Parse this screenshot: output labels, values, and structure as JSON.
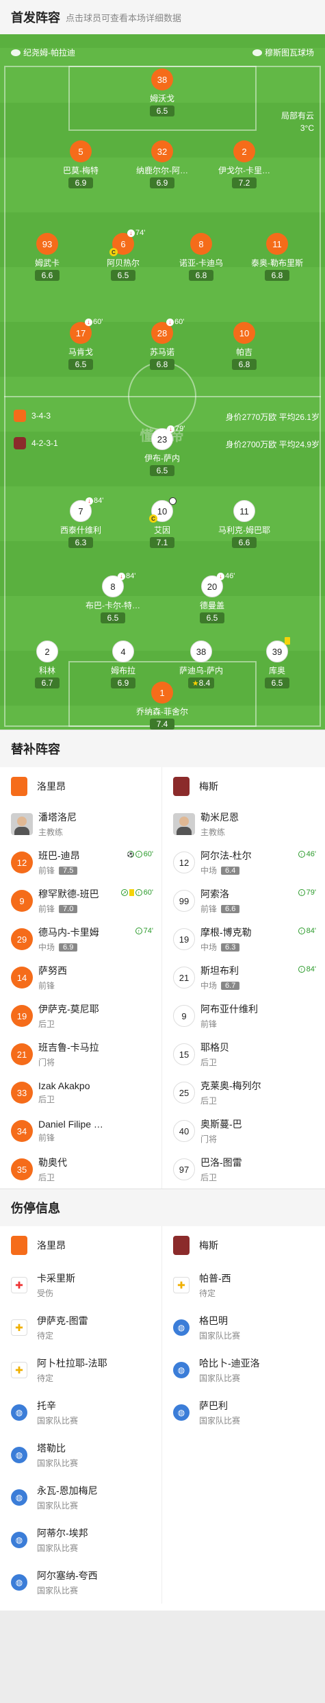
{
  "header": {
    "title": "首发阵容",
    "subtitle": "点击球员可查看本场详细数据"
  },
  "pitch": {
    "team_left": "纪尧姆-帕拉迪",
    "venue": "穆斯图瓦球场",
    "weather": "局部有云",
    "temperature": "3°C",
    "watermark": "懂球帝",
    "home_formation": "3-4-3",
    "home_value": "身价2770万欧 平均26.1岁",
    "away_formation": "4-2-3-1",
    "away_value": "身价2700万欧 平均24.9岁"
  },
  "home_players": [
    {
      "num": "38",
      "name": "姆沃戈",
      "rating": "6.5"
    },
    {
      "num": "5",
      "name": "巴莫-梅特",
      "rating": "6.9"
    },
    {
      "num": "32",
      "name": "纳鹿尔尔-阿…",
      "rating": "6.9"
    },
    {
      "num": "2",
      "name": "伊戈尔-卡里…",
      "rating": "7.2"
    },
    {
      "num": "93",
      "name": "姆武卡",
      "rating": "6.6"
    },
    {
      "num": "6",
      "name": "阿贝热尔",
      "rating": "6.5",
      "event": "74'"
    },
    {
      "num": "8",
      "name": "诺亚-卡迪乌",
      "rating": "6.8"
    },
    {
      "num": "11",
      "name": "泰奥-勒布里斯",
      "rating": "6.8"
    },
    {
      "num": "17",
      "name": "马肯戈",
      "rating": "6.5",
      "event": "60'"
    },
    {
      "num": "28",
      "name": "苏马诺",
      "rating": "6.8",
      "event": "60'"
    },
    {
      "num": "10",
      "name": "帕吉",
      "rating": "6.8"
    }
  ],
  "away_players": [
    {
      "num": "23",
      "name": "伊布-萨内",
      "rating": "6.5",
      "event": "79'"
    },
    {
      "num": "7",
      "name": "西泰什维利",
      "rating": "6.3",
      "event": "84'"
    },
    {
      "num": "10",
      "name": "艾因",
      "rating": "7.1"
    },
    {
      "num": "11",
      "name": "马利克-姆巴耶",
      "rating": "6.6"
    },
    {
      "num": "8",
      "name": "布巴-卡尔-特…",
      "rating": "6.5",
      "event": "84'"
    },
    {
      "num": "20",
      "name": "德曼盖",
      "rating": "6.5",
      "event": "46'"
    },
    {
      "num": "2",
      "name": "科林",
      "rating": "6.7"
    },
    {
      "num": "4",
      "name": "姆布拉",
      "rating": "6.9"
    },
    {
      "num": "38",
      "name": "萨迪乌-萨内",
      "rating": "8.4"
    },
    {
      "num": "39",
      "name": "库奥",
      "rating": "6.5"
    },
    {
      "num": "1",
      "name": "乔纳森-菲舍尔",
      "rating": "7.4"
    }
  ],
  "subs": {
    "title": "替补阵容",
    "home_team": "洛里昂",
    "away_team": "梅斯",
    "home_coach": {
      "name": "潘塔洛尼",
      "role": "主教练"
    },
    "away_coach": {
      "name": "勒米尼恩",
      "role": "主教练"
    },
    "home": [
      {
        "num": "12",
        "name": "班巴-迪昂",
        "pos": "前锋",
        "rating": "7.5",
        "event": "60'"
      },
      {
        "num": "9",
        "name": "穆罕默德-班巴",
        "pos": "前锋",
        "rating": "7.0",
        "event": "60'"
      },
      {
        "num": "29",
        "name": "德马内-卡里姆",
        "pos": "中场",
        "rating": "6.9",
        "event": "74'"
      },
      {
        "num": "14",
        "name": "萨努西",
        "pos": "前锋"
      },
      {
        "num": "19",
        "name": "伊萨克-莫尼耶",
        "pos": "后卫"
      },
      {
        "num": "21",
        "name": "班吉鲁-卡马拉",
        "pos": "门将"
      },
      {
        "num": "33",
        "name": "Izak Akakpo",
        "pos": "后卫"
      },
      {
        "num": "34",
        "name": "Daniel Filipe …",
        "pos": "前锋"
      },
      {
        "num": "35",
        "name": "勒奥代",
        "pos": "后卫"
      }
    ],
    "away": [
      {
        "num": "12",
        "name": "阿尔法-杜尔",
        "pos": "中场",
        "rating": "6.4",
        "event": "46'"
      },
      {
        "num": "99",
        "name": "阿索洛",
        "pos": "前锋",
        "rating": "6.6",
        "event": "79'"
      },
      {
        "num": "19",
        "name": "摩根-博克勒",
        "pos": "中场",
        "rating": "6.3",
        "event": "84'"
      },
      {
        "num": "21",
        "name": "斯坦布利",
        "pos": "中场",
        "rating": "6.7",
        "event": "84'"
      },
      {
        "num": "9",
        "name": "阿布亚什维利",
        "pos": "前锋"
      },
      {
        "num": "15",
        "name": "耶格贝",
        "pos": "后卫"
      },
      {
        "num": "25",
        "name": "克莱奥-梅列尔",
        "pos": "后卫"
      },
      {
        "num": "40",
        "name": "奥斯蔓-巴",
        "pos": "门将"
      },
      {
        "num": "97",
        "name": "巴洛-图雷",
        "pos": "后卫"
      }
    ]
  },
  "injuries": {
    "title": "伤停信息",
    "home_team": "洛里昂",
    "away_team": "梅斯",
    "home": [
      {
        "name": "卡采里斯",
        "status": "受伤",
        "icon": "injury-icon"
      },
      {
        "name": "伊萨克-图雷",
        "status": "待定",
        "icon": "doubtful-icon"
      },
      {
        "name": "阿卜杜拉耶-法耶",
        "status": "待定",
        "icon": "doubtful-icon"
      },
      {
        "name": "托辛",
        "status": "国家队比赛",
        "icon": "globe-icon"
      },
      {
        "name": "塔勒比",
        "status": "国家队比赛",
        "icon": "globe-icon"
      },
      {
        "name": "永瓦-恩加梅尼",
        "status": "国家队比赛",
        "icon": "globe-icon"
      },
      {
        "name": "阿蒂尔-埃邦",
        "status": "国家队比赛",
        "icon": "globe-icon"
      },
      {
        "name": "阿尔塞纳-夸西",
        "status": "国家队比赛",
        "icon": "globe-icon"
      }
    ],
    "away": [
      {
        "name": "帕普-西",
        "status": "待定",
        "icon": "doubtful-icon"
      },
      {
        "name": "格巴明",
        "status": "国家队比赛",
        "icon": "globe-icon"
      },
      {
        "name": "哈比卜-迪亚洛",
        "status": "国家队比赛",
        "icon": "globe-icon"
      },
      {
        "name": "萨巴利",
        "status": "国家队比赛",
        "icon": "globe-icon"
      }
    ]
  },
  "colors": {
    "home": "#f56c1a",
    "pitch": "#5ab03f",
    "rating_bg": "#3d7a2a"
  }
}
